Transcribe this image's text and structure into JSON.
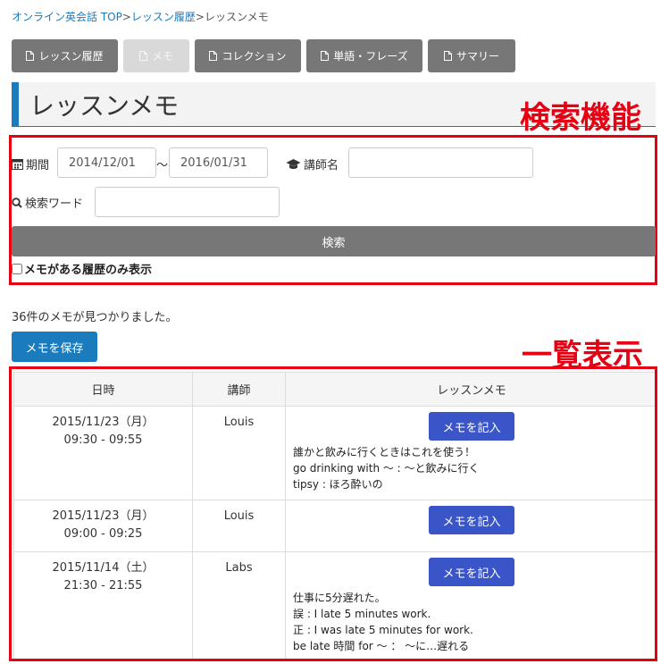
{
  "breadcrumb": {
    "items": [
      {
        "label": "オンライン英会話 TOP",
        "link": true
      },
      {
        "label": ">",
        "link": false
      },
      {
        "label": "レッスン履歴",
        "link": true
      },
      {
        "label": ">",
        "link": false
      },
      {
        "label": "レッスンメモ",
        "link": false
      }
    ]
  },
  "tabs": [
    {
      "label": "レッスン履歴",
      "icon": "document-icon",
      "active": false
    },
    {
      "label": "メモ",
      "icon": "document-icon",
      "active": true
    },
    {
      "label": "コレクション",
      "icon": "document-icon",
      "active": false
    },
    {
      "label": "単語・フレーズ",
      "icon": "document-icon",
      "active": false
    },
    {
      "label": "サマリー",
      "icon": "document-icon",
      "active": false
    }
  ],
  "page_title": "レッスンメモ",
  "annotations": {
    "search": "検索機能",
    "list": "一覧表示"
  },
  "search": {
    "period_label": "期間",
    "date_from": "2014/12/01",
    "date_sep": "〜",
    "date_to": "2016/01/31",
    "teacher_label": "講師名",
    "teacher_value": "",
    "keyword_label": "検索ワード",
    "keyword_value": "",
    "button_label": "検索",
    "memo_only_label": "メモがある履歴のみ表示",
    "memo_only_checked": false
  },
  "result_count": "36件のメモが見つかりました。",
  "save_button": "メモを保存",
  "table": {
    "headers": [
      "日時",
      "講師",
      "レッスンメモ"
    ],
    "write_button": "メモを記入",
    "rows": [
      {
        "date": "2015/11/23（月）",
        "time": "09:30 - 09:55",
        "teacher": "Louis",
        "memo": [
          "誰かと飲みに行くときはこれを使う！",
          "go drinking with ～ : ～と飲みに行く",
          "tipsy : ほろ酔いの"
        ]
      },
      {
        "date": "2015/11/23（月）",
        "time": "09:00 - 09:25",
        "teacher": "Louis",
        "memo": []
      },
      {
        "date": "2015/11/14（土）",
        "time": "21:30 - 21:55",
        "teacher": "Labs",
        "memo": [
          "仕事に5分遅れた。",
          "誤 : I late 5 minutes work.",
          "正 : I was late 5 minutes for work.",
          "be late 時間 for ～ ： ～に…遅れる"
        ]
      }
    ]
  },
  "colors": {
    "accent": "#1a7bbd",
    "annotation_red": "#e60012",
    "tab_gray": "#777777",
    "memo_button": "#3a55c8"
  }
}
